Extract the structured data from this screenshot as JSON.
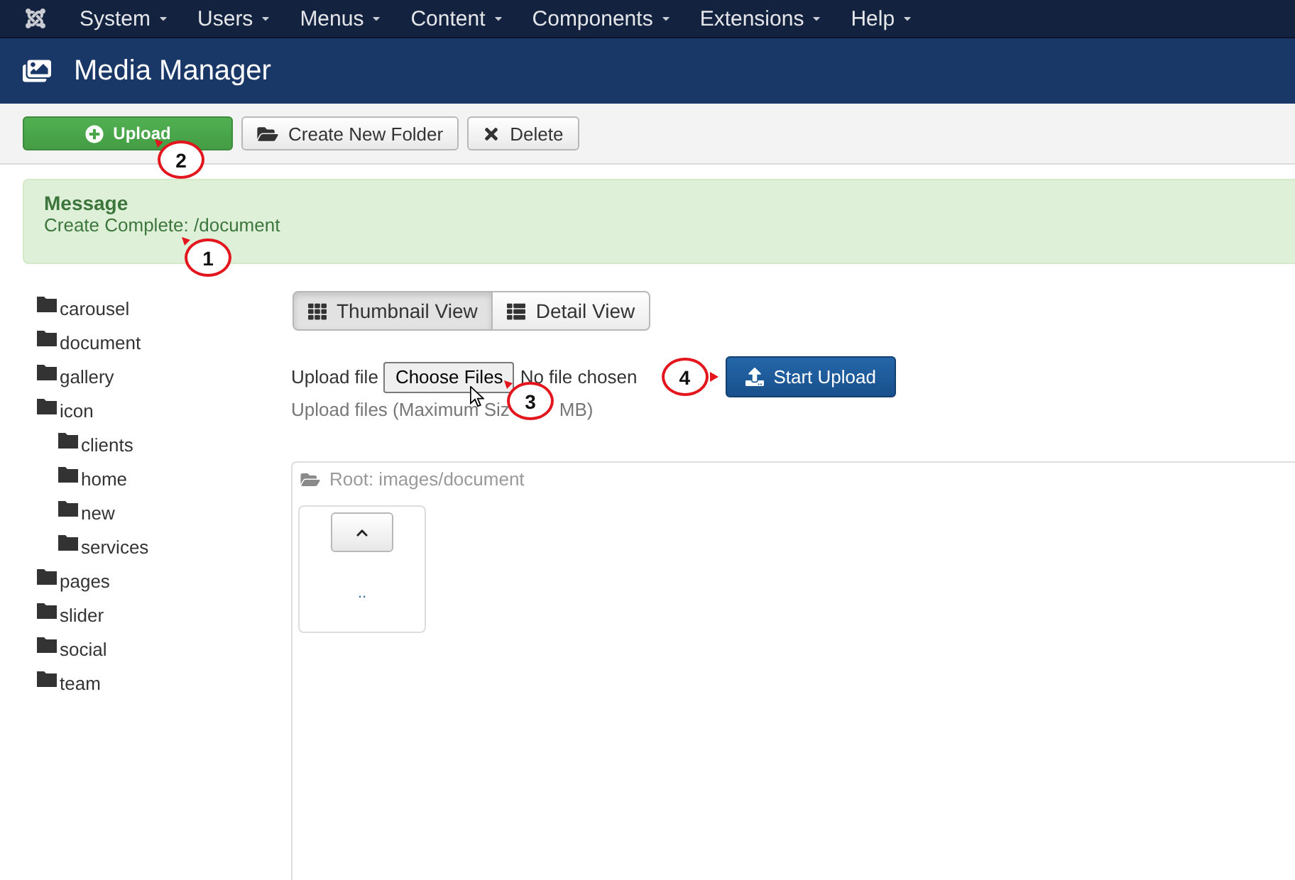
{
  "top_menu": [
    {
      "label": "System"
    },
    {
      "label": "Users"
    },
    {
      "label": "Menus"
    },
    {
      "label": "Content"
    },
    {
      "label": "Components"
    },
    {
      "label": "Extensions"
    },
    {
      "label": "Help"
    }
  ],
  "header": {
    "title": "Media Manager"
  },
  "toolbar": {
    "buttons": [
      {
        "kind": "upload",
        "label": "Upload",
        "callout": "2"
      },
      {
        "kind": "folder",
        "label": "Create New Folder"
      },
      {
        "kind": "delete",
        "label": "Delete"
      }
    ]
  },
  "message": {
    "heading": "Message",
    "text": "Create Complete: /document",
    "callout": "1"
  },
  "folder_tree": [
    {
      "name": "carousel"
    },
    {
      "name": "document"
    },
    {
      "name": "gallery"
    },
    {
      "name": "icon",
      "children": [
        {
          "name": "clients"
        },
        {
          "name": "home"
        },
        {
          "name": "new"
        },
        {
          "name": "services"
        }
      ]
    },
    {
      "name": "pages"
    },
    {
      "name": "slider"
    },
    {
      "name": "social"
    },
    {
      "name": "team"
    }
  ],
  "view_tabs": [
    {
      "kind": "thumbnails",
      "label": "Thumbnail View",
      "selected": true
    },
    {
      "kind": "details",
      "label": "Detail View",
      "selected": false
    }
  ],
  "upload_form": {
    "label": "Upload file",
    "choose_button": "Choose Files",
    "choose_callout": "3",
    "file_status": "No file chosen",
    "start_callout": "4",
    "start_button": "Start Upload",
    "hint_before": "Upload files (Maximum Siz",
    "hint_after": "MB)"
  },
  "browser": {
    "path": "Root: images/document",
    "items": [
      {
        "kind": "parent",
        "label": ".."
      }
    ]
  }
}
